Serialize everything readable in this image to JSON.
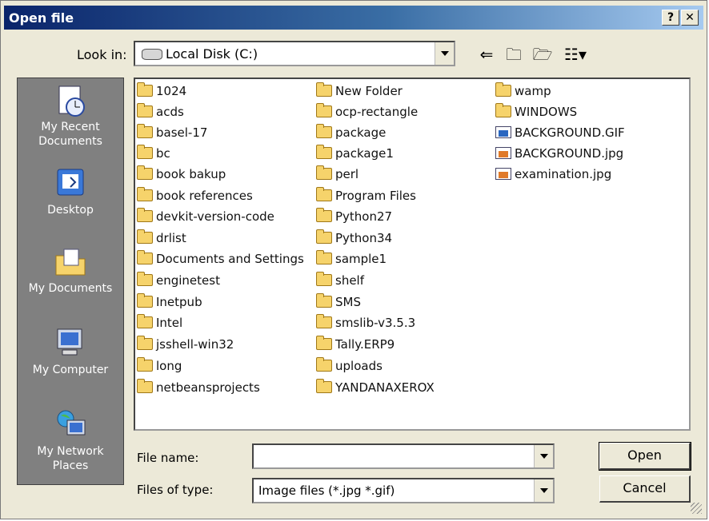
{
  "window": {
    "title": "Open file",
    "help_label": "?",
    "close_label": "✕"
  },
  "lookin": {
    "label": "Look in:",
    "value": "Local Disk (C:)"
  },
  "toolbar": {
    "back": "⇐",
    "up": "🗀",
    "newfolder": "🗁",
    "views": "☷▾"
  },
  "places": [
    {
      "label": "My Recent Documents",
      "icon": "recent-documents-icon"
    },
    {
      "label": "Desktop",
      "icon": "desktop-icon"
    },
    {
      "label": "My Documents",
      "icon": "my-documents-icon"
    },
    {
      "label": "My Computer",
      "icon": "my-computer-icon"
    },
    {
      "label": "My Network Places",
      "icon": "network-places-icon"
    }
  ],
  "files": {
    "col1": [
      "1024",
      "acds",
      "basel-17",
      "bc",
      "book bakup",
      "book references",
      "devkit-version-code",
      "drlist",
      "Documents and Settings",
      "enginetest",
      "Inetpub",
      "Intel",
      "jsshell-win32",
      "long",
      "netbeansprojects"
    ],
    "col2": [
      "New Folder",
      "ocp-rectangle",
      "package",
      "package1",
      "perl",
      "Program Files",
      "Python27",
      "Python34",
      "sample1",
      "shelf",
      "SMS",
      "smslib-v3.5.3",
      "Tally.ERP9",
      "uploads",
      "YANDANAXEROX"
    ],
    "col3": [
      {
        "name": "wamp",
        "type": "folder"
      },
      {
        "name": "WINDOWS",
        "type": "folder"
      },
      {
        "name": "BACKGROUND.GIF",
        "type": "gif"
      },
      {
        "name": "BACKGROUND.jpg",
        "type": "jpg"
      },
      {
        "name": "examination.jpg",
        "type": "jpg"
      }
    ]
  },
  "filename": {
    "label": "File name:",
    "value": ""
  },
  "filetype": {
    "label": "Files of type:",
    "value": "Image files (*.jpg *.gif)"
  },
  "buttons": {
    "open": "Open",
    "cancel": "Cancel"
  }
}
